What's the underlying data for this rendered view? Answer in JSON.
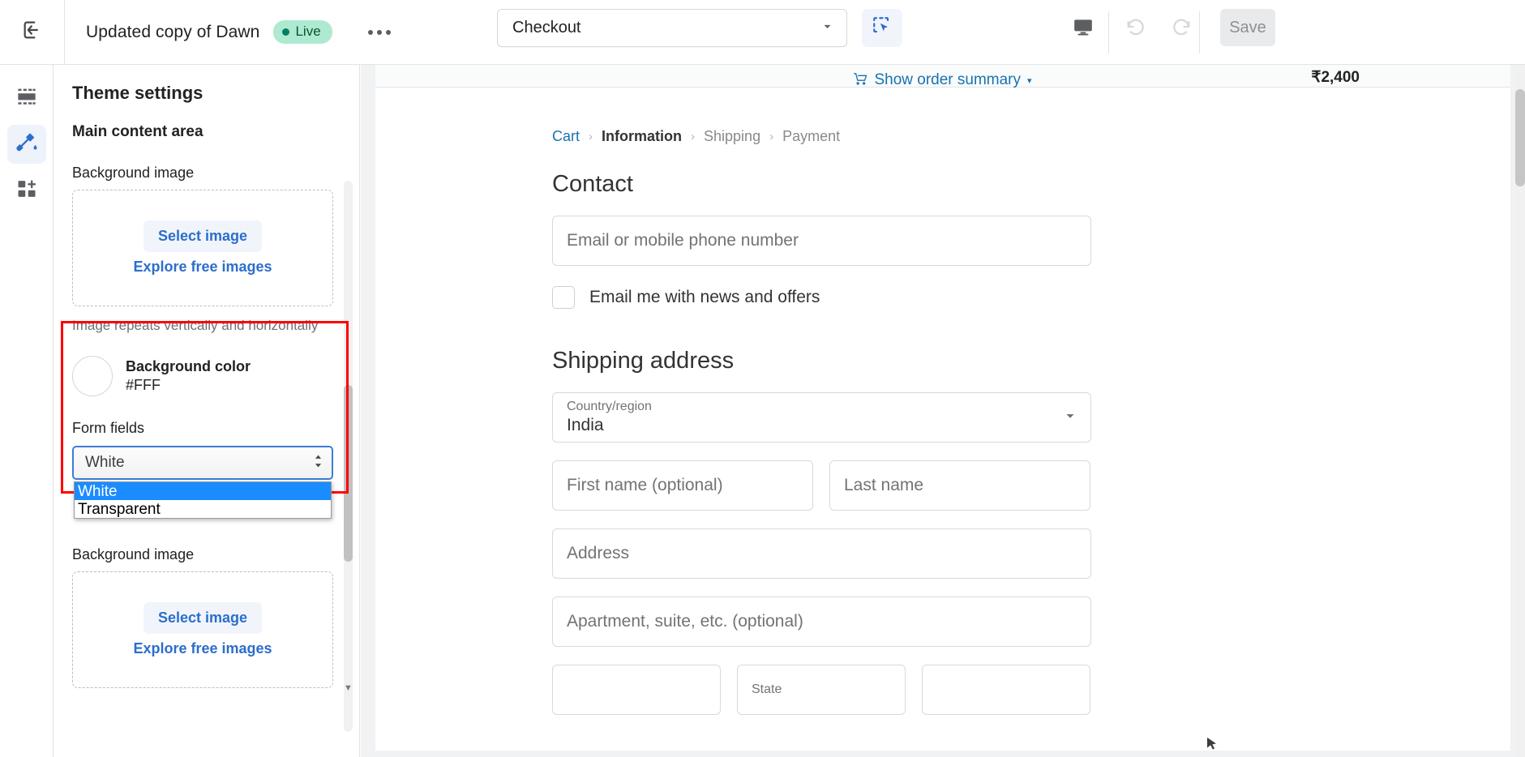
{
  "topbar": {
    "exit_icon": "exit-icon",
    "theme_name": "Updated copy of Dawn",
    "status_badge": "Live",
    "more_label": "•••",
    "page_select_value": "Checkout",
    "select_tool_icon": "marquee-select-icon",
    "device_icon": "desktop-icon",
    "undo_icon": "undo-icon",
    "redo_icon": "redo-icon",
    "save_label": "Save",
    "accent_blue": "#2c6ecb",
    "badge_bg": "#aee9d1",
    "badge_fg": "#0c5132"
  },
  "rail": {
    "items": [
      {
        "name": "sections-icon",
        "label": "Sections",
        "active": false
      },
      {
        "name": "theme-settings-paint-icon",
        "label": "Theme settings",
        "active": true
      },
      {
        "name": "app-embeds-icon",
        "label": "App embeds",
        "active": false
      }
    ]
  },
  "sidebar": {
    "title": "Theme settings",
    "section_title": "Main content area",
    "background_image_label": "Background image",
    "select_image_label": "Select image",
    "explore_free_images_label": "Explore free images",
    "repeat_help": "Image repeats vertically and horizontally",
    "background_color_label": "Background color",
    "background_color_value": "#FFF",
    "form_fields_label": "Form fields",
    "form_fields_value": "White",
    "form_fields_options": [
      "White",
      "Transparent"
    ],
    "form_fields_selected_index": 0,
    "background_image_label_2": "Background image",
    "select_image_label_2": "Select image",
    "explore_free_images_label_2": "Explore free images",
    "highlight_color": "#ff0000",
    "dropdown_highlight_color": "#1a8cff"
  },
  "preview": {
    "order_summary_label": "Show order summary",
    "order_summary_caret": "▾",
    "order_total": "₹2,400",
    "breadcrumb": [
      {
        "label": "Cart",
        "state": "link"
      },
      {
        "label": "Information",
        "state": "current"
      },
      {
        "label": "Shipping",
        "state": "muted"
      },
      {
        "label": "Payment",
        "state": "muted"
      }
    ],
    "breadcrumb_separator": "›",
    "contact_heading": "Contact",
    "email_placeholder": "Email or mobile phone number",
    "newsletter_label": "Email me with news and offers",
    "shipping_heading": "Shipping address",
    "country_label": "Country/region",
    "country_value": "India",
    "first_name_placeholder": "First name (optional)",
    "last_name_placeholder": "Last name",
    "address_placeholder": "Address",
    "apartment_placeholder": "Apartment, suite, etc. (optional)",
    "city_placeholder": "",
    "state_label": "State",
    "zip_placeholder": ""
  }
}
